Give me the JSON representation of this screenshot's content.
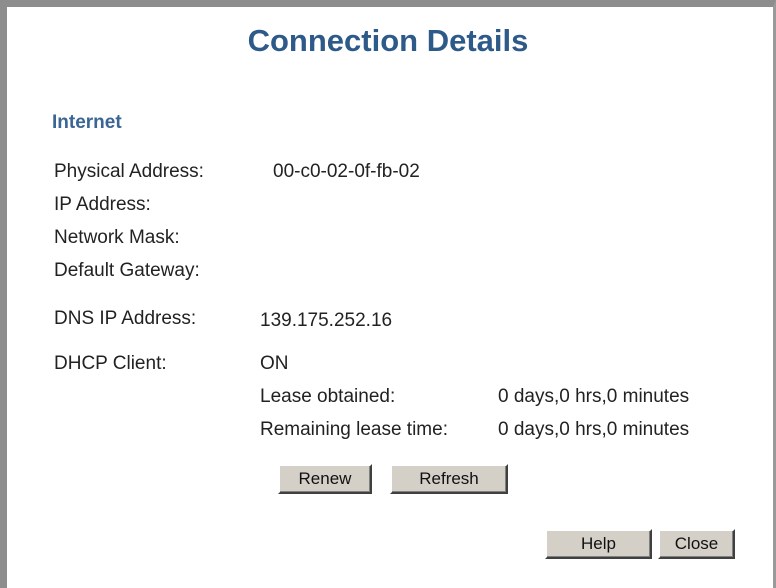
{
  "title": "Connection Details",
  "internet": {
    "heading": "Internet",
    "physical_address_label": "Physical Address:",
    "physical_address_value": "00-c0-02-0f-fb-02",
    "ip_address_label": "IP Address:",
    "network_mask_label": "Network Mask:",
    "default_gateway_label": "Default Gateway:",
    "dns_label": "DNS IP Address:",
    "dns_value": "139.175.252.16",
    "dhcp_label": "DHCP Client:",
    "dhcp_value": "ON",
    "lease_obtained_label": "Lease obtained:",
    "lease_obtained_value": "0 days,0 hrs,0 minutes",
    "remaining_lease_label": "Remaining lease time:",
    "remaining_lease_value": "0 days,0 hrs,0 minutes"
  },
  "buttons": {
    "renew": "Renew",
    "refresh": "Refresh",
    "help": "Help",
    "close": "Close"
  }
}
